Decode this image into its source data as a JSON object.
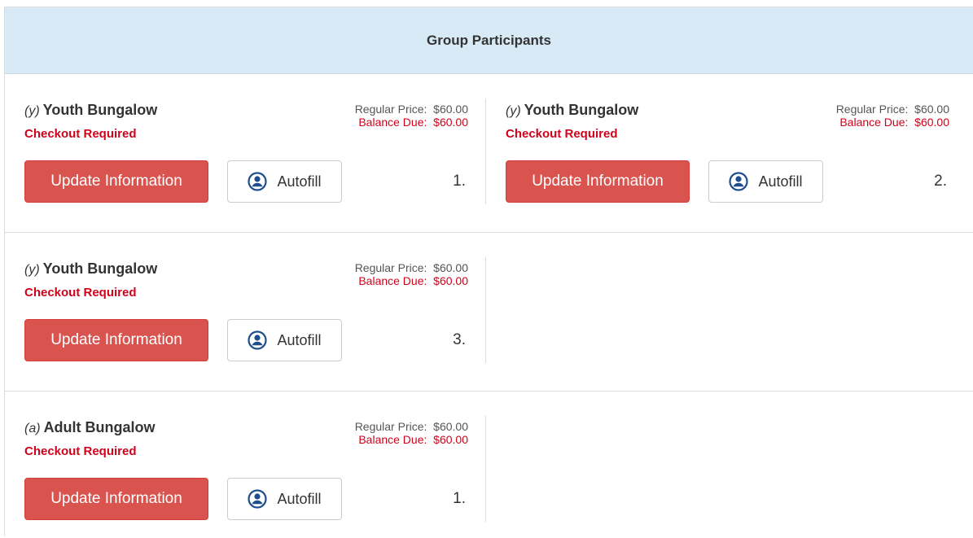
{
  "header": {
    "title": "Group Participants"
  },
  "labels": {
    "regular_price": "Regular Price:",
    "balance_due": "Balance Due:",
    "update_button": "Update Information",
    "autofill_button": "Autofill"
  },
  "rows": [
    [
      {
        "code": "(y)",
        "name": "Youth Bungalow",
        "status": "Checkout Required",
        "regular_price": "$60.00",
        "balance_due": "$60.00",
        "number": "1."
      },
      {
        "code": "(y)",
        "name": "Youth Bungalow",
        "status": "Checkout Required",
        "regular_price": "$60.00",
        "balance_due": "$60.00",
        "number": "2."
      }
    ],
    [
      {
        "code": "(y)",
        "name": "Youth Bungalow",
        "status": "Checkout Required",
        "regular_price": "$60.00",
        "balance_due": "$60.00",
        "number": "3."
      }
    ],
    [
      {
        "code": "(a)",
        "name": "Adult Bungalow",
        "status": "Checkout Required",
        "regular_price": "$60.00",
        "balance_due": "$60.00",
        "number": "1."
      }
    ]
  ],
  "icons": {
    "autofill": "user-circle-icon"
  },
  "colors": {
    "header_bg": "#d9eaf7",
    "danger": "#d9534f",
    "status_red": "#d0021b",
    "icon_blue": "#1f4e8c"
  }
}
